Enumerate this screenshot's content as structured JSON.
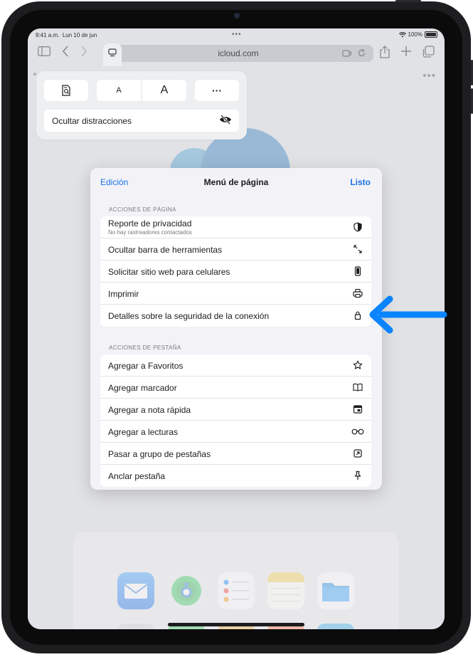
{
  "status_bar": {
    "time": "9:41 a.m.",
    "date": "Lun 10 de jun",
    "battery": "100%"
  },
  "toolbar": {
    "url": "icloud.com",
    "icons": [
      "sidebar-icon",
      "back-icon",
      "forward-icon",
      "page-menu-icon",
      "extension-icon",
      "reload-icon",
      "share-icon",
      "new-tab-icon",
      "tabs-icon"
    ]
  },
  "reader_popover": {
    "font_small": "A",
    "font_large": "A",
    "more": "···",
    "hide_distractions": "Ocultar distracciones"
  },
  "page_menu": {
    "edit": "Edición",
    "title": "Menú de página",
    "done": "Listo",
    "page_actions_title": "ACCIONES DE PÁGINA",
    "page_actions": [
      {
        "label": "Reporte de privacidad",
        "sub": "No hay rastreadores contactados",
        "icon": "privacy-shield-icon"
      },
      {
        "label": "Ocultar barra de herramientas",
        "icon": "expand-arrows-icon"
      },
      {
        "label": "Solicitar sitio web para celulares",
        "icon": "phone-icon"
      },
      {
        "label": "Imprimir",
        "icon": "printer-icon"
      },
      {
        "label": "Detalles sobre la seguridad de la conexión",
        "icon": "lock-icon"
      }
    ],
    "tab_actions_title": "ACCIONES DE PESTAÑA",
    "tab_actions": [
      {
        "label": "Agregar a Favoritos",
        "icon": "star-icon"
      },
      {
        "label": "Agregar marcador",
        "icon": "book-icon"
      },
      {
        "label": "Agregar a nota rápida",
        "icon": "quick-note-icon"
      },
      {
        "label": "Agregar a lecturas",
        "icon": "glasses-icon"
      },
      {
        "label": "Pasar a grupo de pestañas",
        "icon": "move-to-group-icon"
      },
      {
        "label": "Anclar pestaña",
        "icon": "pin-icon"
      }
    ]
  },
  "dock": {
    "apps": [
      "Mail",
      "Find My",
      "Reminders",
      "Notes",
      "Files"
    ]
  },
  "colors": {
    "accent": "#1a73e8",
    "arrow": "#0a84ff"
  }
}
